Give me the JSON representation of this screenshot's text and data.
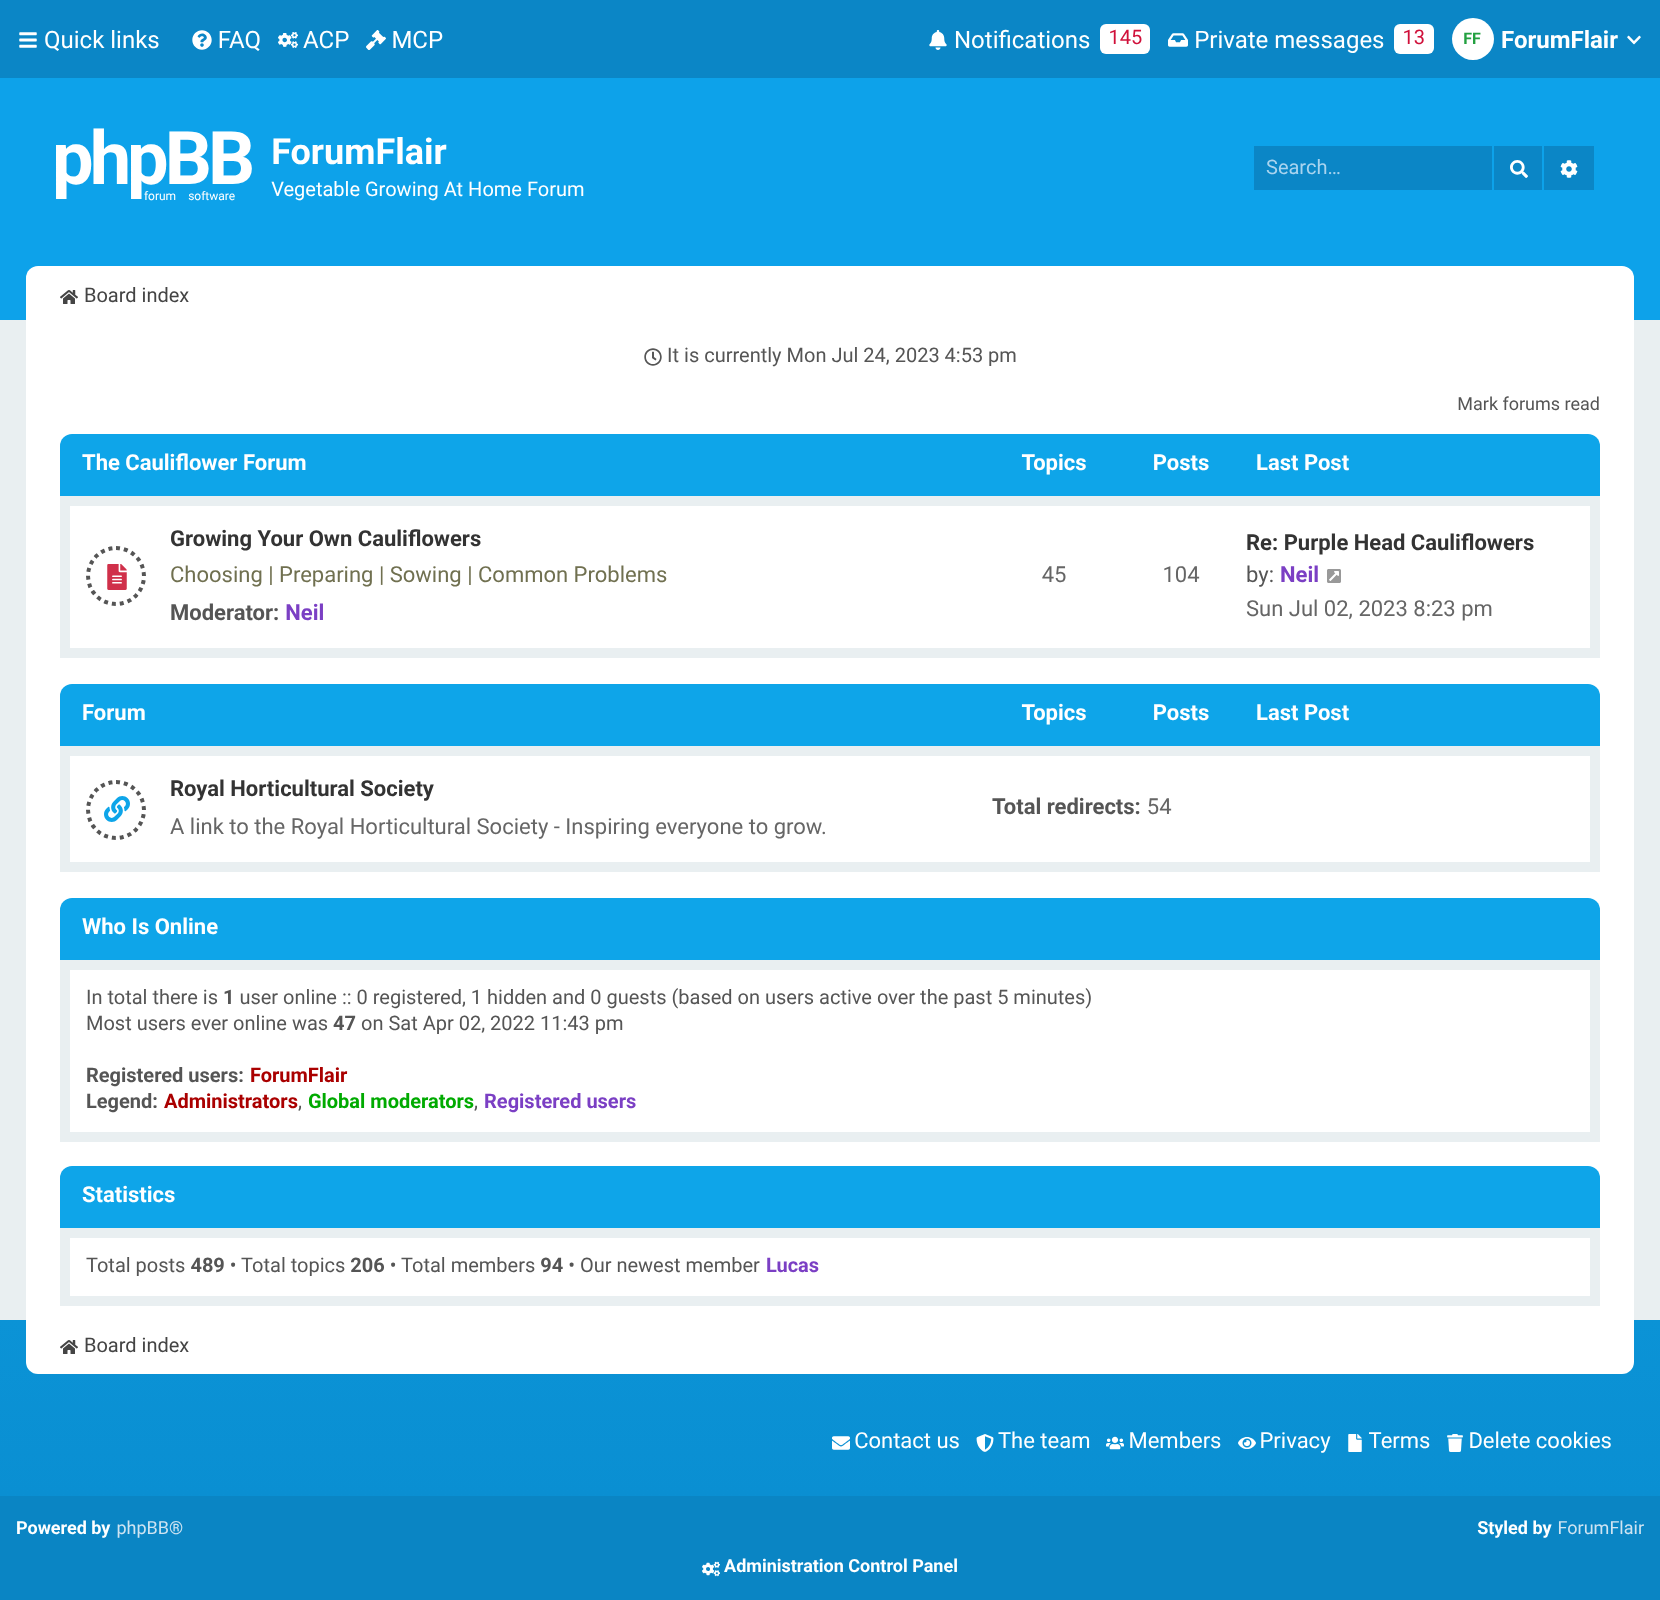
{
  "top_nav": {
    "links": [
      {
        "label": "Quick links"
      },
      {
        "label": "FAQ"
      },
      {
        "label": "ACP"
      },
      {
        "label": "MCP"
      }
    ],
    "notifications": {
      "label": "Notifications",
      "count": "145"
    },
    "private_messages": {
      "label": "Private messages",
      "count": "13"
    },
    "user": {
      "name": "ForumFlair",
      "avatar_text": "FF"
    }
  },
  "header": {
    "logo": "phpBB",
    "logo_sub_left": "forum",
    "logo_sub_right": "software",
    "site_title": "ForumFlair",
    "site_description": "Vegetable Growing At Home Forum",
    "search": {
      "placeholder": "Search…"
    }
  },
  "breadcrumb": "Board index",
  "current_time": "It is currently Mon Jul 24, 2023 4:53 pm",
  "mark_read": "Mark forums read",
  "categories": [
    {
      "title": "The Cauliflower Forum",
      "columns": [
        "Topics",
        "Posts",
        "Last Post"
      ],
      "forums": [
        {
          "kind": "forum",
          "name": "Growing Your Own Cauliflowers",
          "subforums": "Choosing | Preparing | Sowing | Common Problems",
          "moderator_label": "Moderator:",
          "moderator": "Neil",
          "topics": "45",
          "posts": "104",
          "last_post": {
            "title": "Re: Purple Head Cauliflowers",
            "by_label": "by:",
            "author": "Neil",
            "date": "Sun Jul 02, 2023 8:23 pm"
          }
        }
      ]
    },
    {
      "title": "Forum",
      "columns": [
        "Topics",
        "Posts",
        "Last Post"
      ],
      "forums": [
        {
          "kind": "link",
          "name": "Royal Horticultural Society",
          "description": "A link to the Royal Horticultural Society - Inspiring everyone to grow.",
          "redirects_label": "Total redirects:",
          "redirects": "54"
        }
      ]
    }
  ],
  "who_is_online": {
    "title": "Who Is Online",
    "lines": [
      "In total there is **1** user online :: 0 registered, 1 hidden and 0 guests (based on users active over the past 5 minutes)",
      "Most users ever online was **47** on Sat Apr 02, 2022 11:43 pm"
    ],
    "registered_label": "Registered users:",
    "registered_users": [
      {
        "name": "ForumFlair",
        "color": "#aa0000"
      }
    ],
    "legend_label": "Legend:",
    "legend_separator": ",",
    "legend": [
      {
        "name": "Administrators",
        "color": "#aa0000"
      },
      {
        "name": "Global moderators",
        "color": "#00aa00"
      },
      {
        "name": "Registered users",
        "color": "#7b3fc4"
      }
    ]
  },
  "statistics": {
    "title": "Statistics",
    "text": "Total posts **489** • Total topics **206** • Total members **94** • Our newest member",
    "newest_member": "Lucas"
  },
  "footer_breadcrumb": "Board index",
  "footer_links": [
    {
      "label": "Contact us"
    },
    {
      "label": "The team"
    },
    {
      "label": "Members"
    },
    {
      "label": "Privacy"
    },
    {
      "label": "Terms"
    },
    {
      "label": "Delete cookies"
    }
  ],
  "powered_by": {
    "label": "Powered by",
    "link": "phpBB®"
  },
  "styled_by": {
    "label": "Styled by",
    "link": "ForumFlair"
  },
  "acp_link": "Administration Control Panel"
}
